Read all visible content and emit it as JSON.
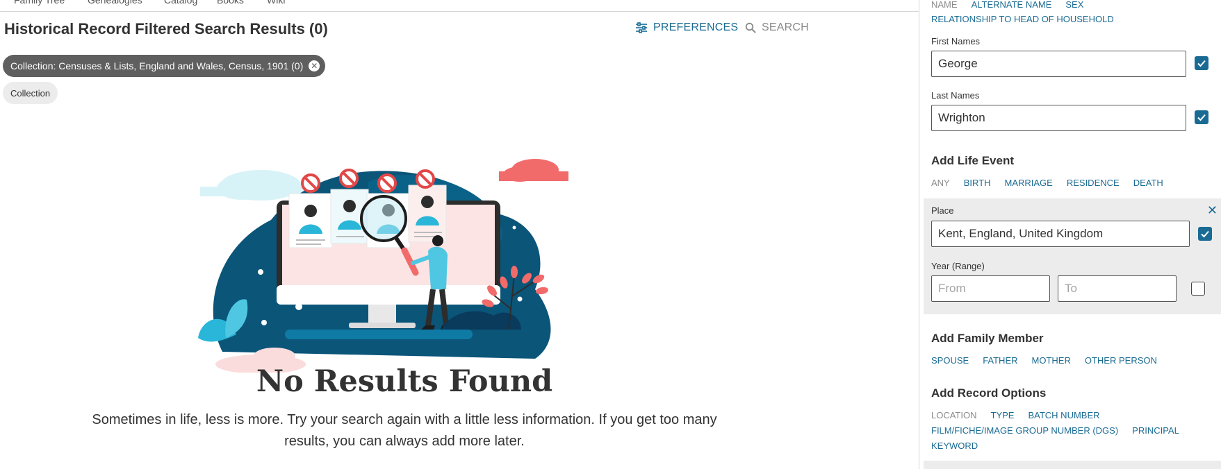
{
  "nav": {
    "items": [
      "Family Tree",
      "Genealogies",
      "Catalog",
      "Books",
      "Wiki"
    ]
  },
  "header": {
    "title": "Historical Record Filtered Search Results (0)",
    "preferences_label": "PREFERENCES",
    "search_label": "SEARCH"
  },
  "filters": {
    "active_chip": "Collection: Censuses & Lists, England and Wales, Census, 1901 (0)",
    "collection_chip": "Collection"
  },
  "empty_state": {
    "title": "No Results Found",
    "message": "Sometimes in life, less is more. Try your search again with a little less information. If you get too many results, you can always add more later."
  },
  "panel": {
    "name_tabs": [
      "NAME",
      "ALTERNATE NAME",
      "SEX"
    ],
    "relationship_link": "RELATIONSHIP TO HEAD OF HOUSEHOLD",
    "first_names": {
      "label": "First Names",
      "value": "George",
      "exact": true
    },
    "last_names": {
      "label": "Last Names",
      "value": "Wrighton",
      "exact": true
    },
    "life_event": {
      "title": "Add Life Event",
      "options": [
        "ANY",
        "BIRTH",
        "MARRIAGE",
        "RESIDENCE",
        "DEATH"
      ],
      "place_label": "Place",
      "place_value": "Kent, England, United Kingdom",
      "place_exact": true,
      "year_label": "Year (Range)",
      "from_placeholder": "From",
      "to_placeholder": "To",
      "year_exact": false,
      "close_icon": "close-icon"
    },
    "family_member": {
      "title": "Add Family Member",
      "options": [
        "SPOUSE",
        "FATHER",
        "MOTHER",
        "OTHER PERSON"
      ]
    },
    "record_options": {
      "title": "Add Record Options",
      "options": [
        "LOCATION",
        "TYPE",
        "BATCH NUMBER",
        "FILM/FICHE/IMAGE GROUP NUMBER (DGS)",
        "PRINCIPAL",
        "KEYWORD"
      ]
    }
  },
  "colors": {
    "link": "#1a6b94",
    "chip_dark": "#5f5f5f",
    "event_bg": "#ececec",
    "illustration_navy": "#0b5579",
    "illustration_cyan": "#29b6d8",
    "illustration_coral": "#f26b6b"
  }
}
